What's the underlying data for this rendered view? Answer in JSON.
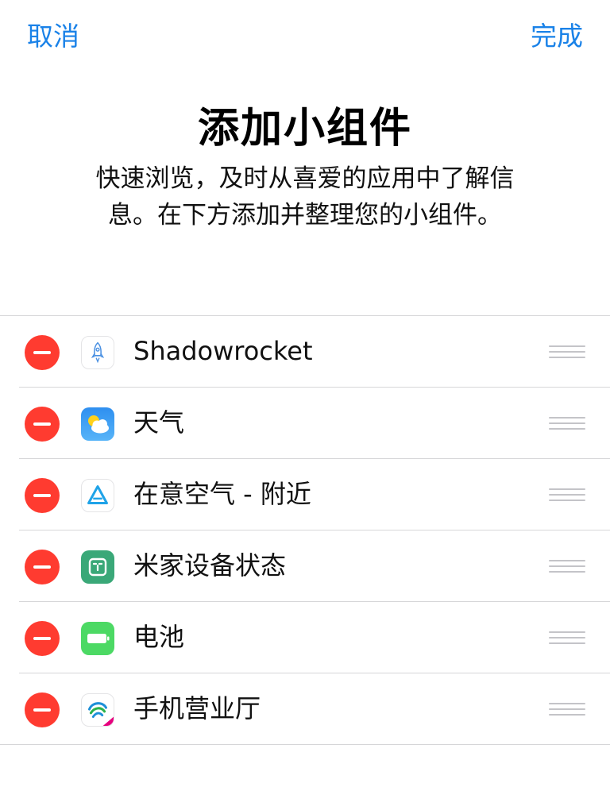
{
  "nav": {
    "cancel_label": "取消",
    "done_label": "完成"
  },
  "header": {
    "title": "添加小组件",
    "subtitle_line1": "快速浏览，及时从喜爱的应用中了解信",
    "subtitle_line2": "息。在下方添加并整理您的小组件。"
  },
  "widgets": [
    {
      "label": "Shadowrocket",
      "icon": "rocket-icon"
    },
    {
      "label": "天气",
      "icon": "weather-icon"
    },
    {
      "label": "在意空气 - 附近",
      "icon": "air-quality-icon"
    },
    {
      "label": "米家设备状态",
      "icon": "mijia-icon"
    },
    {
      "label": "电池",
      "icon": "battery-icon"
    },
    {
      "label": "手机营业厅",
      "icon": "china-mobile-icon"
    }
  ],
  "colors": {
    "accent": "#1a82e8",
    "remove": "#ff3b30"
  }
}
